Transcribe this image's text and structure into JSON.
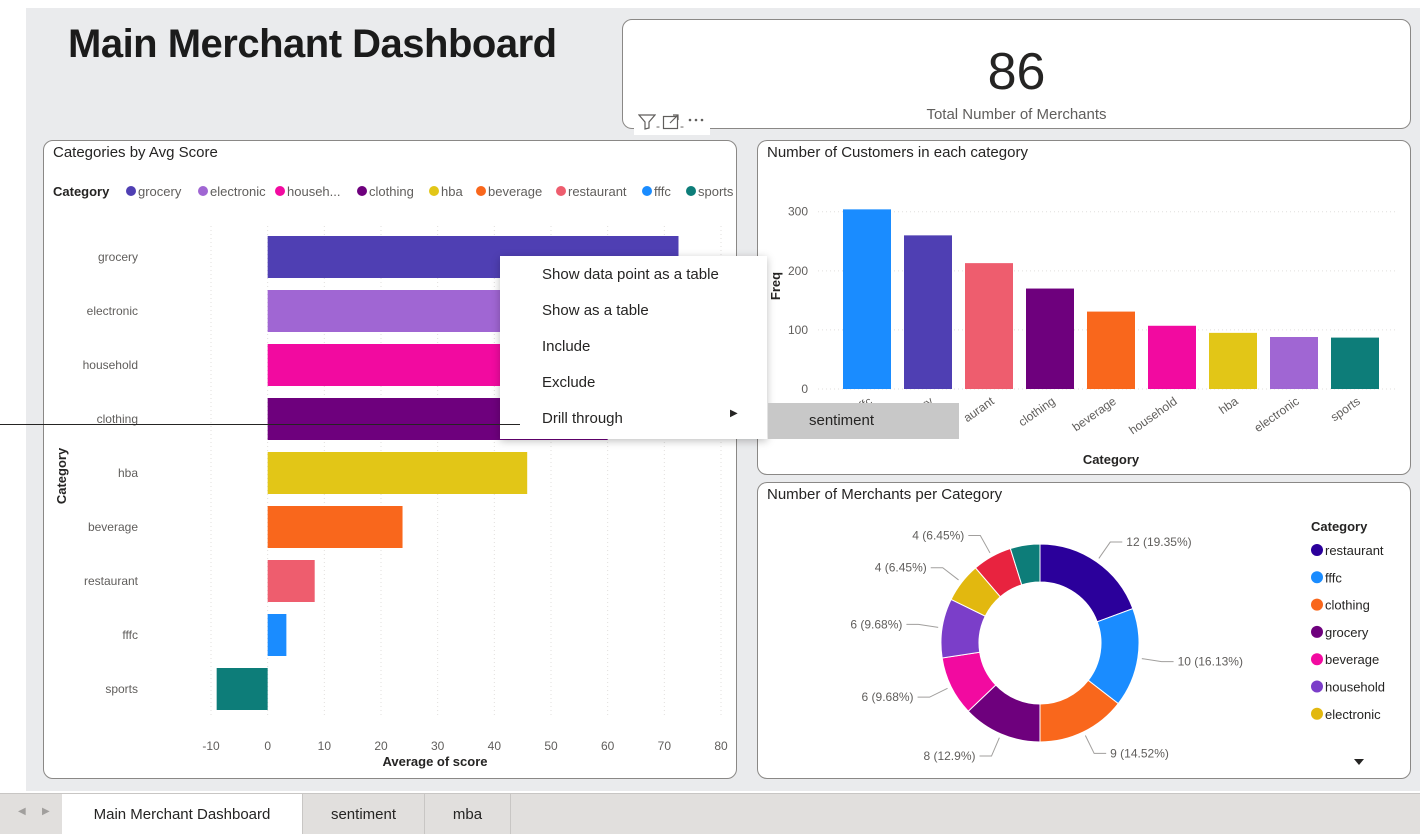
{
  "page": {
    "title": "Main Merchant Dashboard"
  },
  "kpi": {
    "value": "86",
    "label": "Total Number of Merchants"
  },
  "visual_header_icons": [
    "filter-icon",
    "focus-mode-icon",
    "more-options-icon"
  ],
  "bar_chart": {
    "title": "Categories by Avg Score",
    "legend_title": "Category",
    "legend": [
      {
        "label": "grocery",
        "color": "#4f3fb3"
      },
      {
        "label": "electronic",
        "color": "#a066d3"
      },
      {
        "label": "househ...",
        "color": "#f20aa0"
      },
      {
        "label": "clothing",
        "color": "#6e007d"
      },
      {
        "label": "hba",
        "color": "#e2c617"
      },
      {
        "label": "beverage",
        "color": "#f9671c"
      },
      {
        "label": "restaurant",
        "color": "#ee5d6e"
      },
      {
        "label": "fffc",
        "color": "#1a8cff"
      },
      {
        "label": "sports",
        "color": "#0d7d79"
      }
    ]
  },
  "customers_chart": {
    "title": "Number of Customers in each category"
  },
  "merchants_chart": {
    "title": "Number of Merchants per Category",
    "legend_title": "Category"
  },
  "chart_data": [
    {
      "type": "bar",
      "orientation": "horizontal",
      "title": "Categories by Avg Score",
      "categories": [
        "grocery",
        "electronic",
        "household",
        "clothing",
        "hba",
        "beverage",
        "restaurant",
        "fffc",
        "sports"
      ],
      "values": [
        72.5,
        66,
        64,
        60,
        45.8,
        23.8,
        8.3,
        3.3,
        -9
      ],
      "colors": [
        "#4f3fb3",
        "#a066d3",
        "#f20aa0",
        "#6e007d",
        "#e2c617",
        "#f9671c",
        "#ee5d6e",
        "#1a8cff",
        "#0d7d79"
      ],
      "xlabel": "Average of score",
      "ylabel": "Category",
      "xlim": [
        -10,
        80
      ],
      "xticks": [
        "-10",
        "0",
        "10",
        "20",
        "30",
        "40",
        "50",
        "60",
        "70",
        "80"
      ],
      "grid": true
    },
    {
      "type": "bar",
      "title": "Number of Customers in each category",
      "categories": [
        "fffc",
        "grocery",
        "restaurant",
        "clothing",
        "beverage",
        "household",
        "hba",
        "electronic",
        "sports"
      ],
      "tick_labels": [
        "ffc",
        "ry",
        "aurant",
        "clothing",
        "beverage",
        "household",
        "hba",
        "electronic",
        "sports"
      ],
      "values": [
        304,
        260,
        213,
        170,
        131,
        107,
        95,
        88,
        87
      ],
      "colors": [
        "#1a8cff",
        "#4f3fb3",
        "#ee5d6e",
        "#6e007d",
        "#f9671c",
        "#f20aa0",
        "#e2c617",
        "#a066d3",
        "#0d7d79"
      ],
      "xlabel": "Category",
      "ylabel": "Freq",
      "ylim": [
        0,
        330
      ],
      "yticks": [
        "0",
        "100",
        "200",
        "300"
      ],
      "grid": true
    },
    {
      "type": "pie",
      "donut": true,
      "title": "Number of Merchants per Category",
      "slices": [
        {
          "label": "restaurant",
          "value": 12,
          "text": "12 (19.35%)",
          "color": "#2b009b"
        },
        {
          "label": "fffc",
          "value": 10,
          "text": "10 (16.13%)",
          "color": "#1a8cff"
        },
        {
          "label": "clothing",
          "value": 9,
          "text": "9 (14.52%)",
          "color": "#f9671c"
        },
        {
          "label": "grocery",
          "value": 8,
          "text": "8 (12.9%)",
          "color": "#6e007d"
        },
        {
          "label": "beverage",
          "value": 6,
          "text": "6 (9.68%)",
          "color": "#f20aa0"
        },
        {
          "label": "household",
          "value": 6,
          "text": "6 (9.68%)",
          "color": "#7b3ec9"
        },
        {
          "label": "electronic",
          "value": 4,
          "text": "4 (6.45%)",
          "color": "#e2b80f"
        },
        {
          "label": "hba",
          "value": 4,
          "text": "4 (6.45%)",
          "color": "#e8233f"
        },
        {
          "label": "sports",
          "value": 3,
          "text": "",
          "color": "#0d7d79"
        }
      ],
      "legend_title": "Category",
      "legend_visible": [
        "restaurant",
        "fffc",
        "clothing",
        "grocery",
        "beverage",
        "household",
        "electronic"
      ],
      "legend_position": "right"
    }
  ],
  "context_menu": {
    "items": [
      "Show data point as a table",
      "Show as a table",
      "Include",
      "Exclude",
      "Drill through"
    ],
    "submenu": [
      "sentiment"
    ]
  },
  "tabs": {
    "items": [
      "Main Merchant Dashboard",
      "sentiment",
      "mba"
    ],
    "active": 0
  }
}
